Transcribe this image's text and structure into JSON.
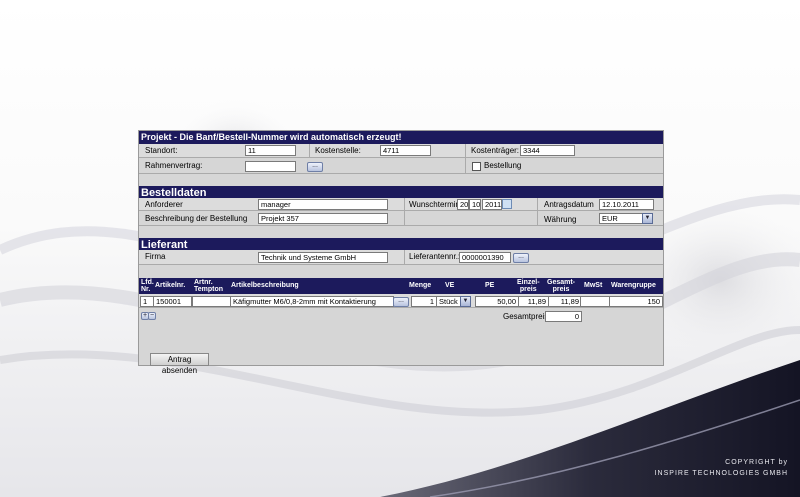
{
  "projekt": {
    "title": "Projekt - Die Banf/Bestell-Nummer wird automatisch erzeugt!",
    "standort_label": "Standort:",
    "standort_value": "11",
    "kostenstelle_label": "Kostenstelle:",
    "kostenstelle_value": "4711",
    "kostentraeger_label": "Kostenträger:",
    "kostentraeger_value": "3344",
    "rahmenvertrag_label": "Rahmenvertrag:",
    "rahmenvertrag_value": "",
    "lookup_label": "...",
    "bestellung_label": "Bestellung",
    "bestellung_checked": false
  },
  "bestelldaten": {
    "title": "Bestelldaten",
    "anforderer_label": "Anforderer",
    "anforderer_value": "manager",
    "wunschtermin_label": "Wunschtermin",
    "wunschtermin_day": "20",
    "wunschtermin_month": "10",
    "wunschtermin_year": "2011",
    "antragsdatum_label": "Antragsdatum",
    "antragsdatum_value": "12.10.2011",
    "beschreibung_label": "Beschreibung der Bestellung",
    "beschreibung_value": "Projekt 357",
    "waehrung_label": "Währung",
    "waehrung_value": "EUR"
  },
  "lieferant": {
    "title": "Lieferant",
    "firma_label": "Firma",
    "firma_value": "Technik und Systeme GmbH",
    "lieferantennr_label": "Lieferantennr.:",
    "lieferantennr_value": "0000001390",
    "lookup_label": "..."
  },
  "positions": {
    "headers": {
      "lfd_line1": "Lfd.",
      "lfd_line2": "Nr.",
      "artikelnr": "Artikelnr.",
      "artnr_line1": "Artnr.",
      "artnr_line2": "Tempton",
      "beschreibung": "Artikelbeschreibung",
      "menge": "Menge",
      "ve": "VE",
      "pe": "PE",
      "einzel_line1": "Einzel-",
      "einzel_line2": "preis",
      "gesamt_line1": "Gesamt-",
      "gesamt_line2": "preis",
      "mwst": "MwSt",
      "warengruppe": "Warengruppe"
    },
    "row": {
      "lfd": "1",
      "artikelnr": "150001",
      "artnr_tempton": "",
      "beschreibung": "Käfigmutter M6/0,8-2mm mit Kontaktierung",
      "lookup_label": "...",
      "menge": "1",
      "ve": "Stück",
      "pe": "50,00",
      "einzelpreis": "11,89",
      "gesamtpreis": "11,89",
      "mwst": "",
      "warengruppe": "150"
    },
    "add_label": "+",
    "remove_label": "−",
    "gesamtpreis_label": "Gesamtpreis:",
    "gesamtpreis_value": "0"
  },
  "submit_label": "Antrag absenden",
  "copyright_line1": "COPYRIGHT by",
  "copyright_line2": "INSPIRE TECHNOLOGIES GMBH",
  "colors": {
    "header_bg": "#1c1a5c",
    "form_bg": "#d6d6d6",
    "footer_wave": "#1a1a2e"
  }
}
